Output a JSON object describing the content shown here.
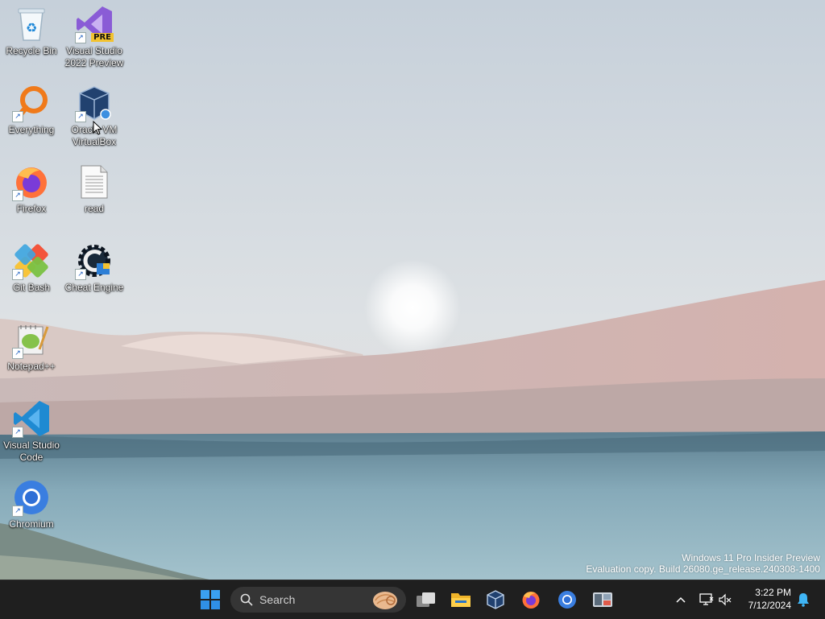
{
  "desktop": {
    "icons": [
      {
        "label": "Recycle Bin"
      },
      {
        "label": "Visual Studio\n2022 Preview",
        "badge": "PRE"
      },
      {
        "label": "Everything"
      },
      {
        "label": "Oracle VM\nVirtualBox"
      },
      {
        "label": "Firefox"
      },
      {
        "label": "read"
      },
      {
        "label": "Git Bash"
      },
      {
        "label": "Cheat Engine"
      },
      {
        "label": "Notepad++"
      },
      {
        "label": "Visual Studio\nCode"
      },
      {
        "label": "Chromium"
      }
    ],
    "watermark": {
      "line1": "Windows 11 Pro Insider Preview",
      "line2": "Evaluation copy. Build 26080.ge_release.240308-1400"
    }
  },
  "taskbar": {
    "search_placeholder": "Search",
    "apps": [
      "start-icon",
      "search-icon",
      "task-view-icon",
      "file-explorer-icon",
      "virtualbox-icon",
      "firefox-icon",
      "chromium-icon",
      "cheat-engine-icon"
    ],
    "tray": {
      "time": "3:22 PM",
      "date": "7/12/2024"
    }
  },
  "colors": {
    "taskbar_bg": "#1f1f1f",
    "accent": "#0a84ff"
  }
}
